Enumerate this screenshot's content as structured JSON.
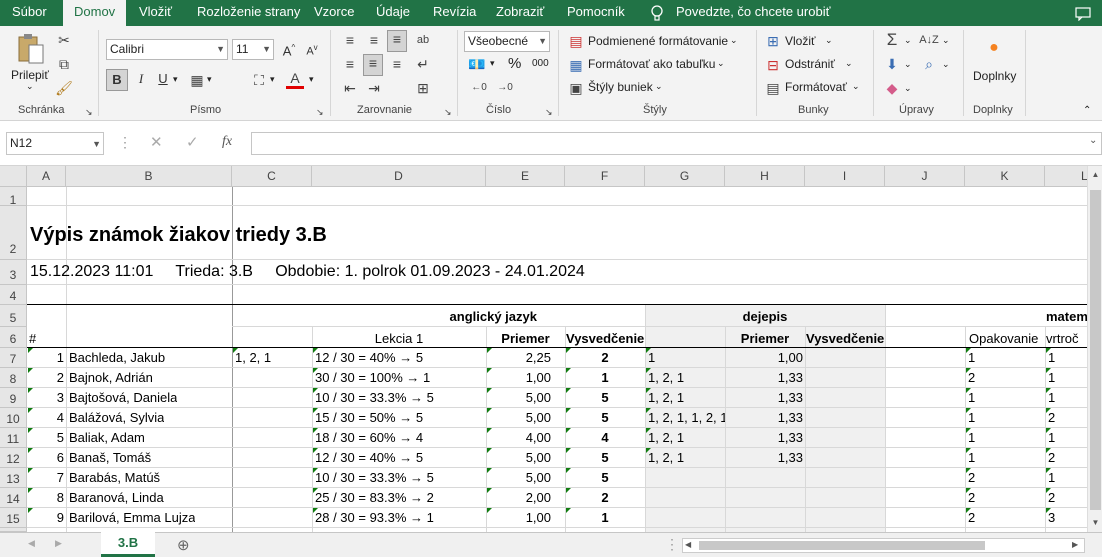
{
  "ribbon_tabs": [
    "Súbor",
    "Domov",
    "Vložiť",
    "Rozloženie strany",
    "Vzorce",
    "Údaje",
    "Revízia",
    "Zobraziť",
    "Pomocník"
  ],
  "active_tab": "Domov",
  "tell_me": "Povedzte, čo chcete urobiť",
  "groups": {
    "clipboard": {
      "paste": "Prilepiť",
      "label": "Schránka"
    },
    "font": {
      "name": "Calibri",
      "size": "11",
      "label": "Písmo",
      "bold": "B",
      "italic": "I",
      "underline": "U"
    },
    "alignment": {
      "label": "Zarovnanie"
    },
    "number": {
      "format": "Všeobecné",
      "label": "Číslo",
      "percent": "%",
      "thousands": "000"
    },
    "styles": {
      "cond": "Podmienené formátovanie",
      "table": "Formátovať ako tabuľku",
      "cell": "Štýly buniek",
      "label": "Štýly"
    },
    "cells": {
      "insert": "Vložiť",
      "delete": "Odstrániť",
      "format": "Formátovať",
      "label": "Bunky"
    },
    "editing": {
      "label": "Úpravy"
    },
    "addins": {
      "button": "Doplnky",
      "label": "Doplnky"
    }
  },
  "name_box": "N12",
  "formula": "",
  "fx": "fx",
  "columns": [
    "A",
    "B",
    "C",
    "D",
    "E",
    "F",
    "G",
    "H",
    "I",
    "J",
    "K",
    "L"
  ],
  "rows": [
    "1",
    "2",
    "3",
    "4",
    "5",
    "6",
    "7",
    "8",
    "9",
    "10",
    "11",
    "12",
    "13",
    "14",
    "15"
  ],
  "title": "Výpis známok žiakov triedy 3.B",
  "subtitle": "15.12.2023 11:01     Trieda: 3.B     Obdobie: 1. polrok 01.09.2023 - 24.01.2024",
  "headers": {
    "english": "anglický jazyk",
    "history": "dejepis",
    "math": "matem",
    "hash": "#",
    "lekcia": "Lekcia 1",
    "priemer": "Priemer",
    "vysvedcenie": "Vysvedčenie",
    "priemer2": "Priemer",
    "vysvedcenie2": "Vysvedčenie",
    "opakovanie": "Opakovanie",
    "vrtroc": "vrtroč"
  },
  "students": [
    {
      "n": "1",
      "name": "Bachleda, Jakub",
      "c": "1, 2, 1",
      "d": "12 / 30 = 40% → 5",
      "e": "2,25",
      "f": "2",
      "g": "1",
      "h": "1,00",
      "k": "1",
      "l": "1"
    },
    {
      "n": "2",
      "name": "Bajnok, Adrián",
      "c": "",
      "d": "30 / 30 = 100% → 1",
      "e": "1,00",
      "f": "1",
      "g": "1, 2, 1",
      "h": "1,33",
      "k": "2",
      "l": "1"
    },
    {
      "n": "3",
      "name": "Bajtošová, Daniela",
      "c": "",
      "d": "10 / 30 = 33.3% → 5",
      "e": "5,00",
      "f": "5",
      "g": "1, 2, 1",
      "h": "1,33",
      "k": "1",
      "l": "1"
    },
    {
      "n": "4",
      "name": "Balážová, Sylvia",
      "c": "",
      "d": "15 / 30 = 50% → 5",
      "e": "5,00",
      "f": "5",
      "g": "1, 2, 1, 1, 2, 1",
      "h": "1,33",
      "k": "1",
      "l": "2"
    },
    {
      "n": "5",
      "name": "Baliak, Adam",
      "c": "",
      "d": "18 / 30 = 60% → 4",
      "e": "4,00",
      "f": "4",
      "g": "1, 2, 1",
      "h": "1,33",
      "k": "1",
      "l": "1"
    },
    {
      "n": "6",
      "name": "Banaš, Tomáš",
      "c": "",
      "d": "12 / 30 = 40% → 5",
      "e": "5,00",
      "f": "5",
      "g": "1, 2, 1",
      "h": "1,33",
      "k": "1",
      "l": "2"
    },
    {
      "n": "7",
      "name": "Barabás, Matúš",
      "c": "",
      "d": "10 / 30 = 33.3% → 5",
      "e": "5,00",
      "f": "5",
      "g": "",
      "h": "",
      "k": "2",
      "l": "1"
    },
    {
      "n": "8",
      "name": "Baranová, Linda",
      "c": "",
      "d": "25 / 30 = 83.3% → 2",
      "e": "2,00",
      "f": "2",
      "g": "",
      "h": "",
      "k": "2",
      "l": "2"
    },
    {
      "n": "9",
      "name": "Barilová, Emma Lujza",
      "c": "",
      "d": "28 / 30 = 93.3% → 1",
      "e": "1,00",
      "f": "1",
      "g": "",
      "h": "",
      "k": "2",
      "l": "3"
    }
  ],
  "sheet_tab": "3.B"
}
